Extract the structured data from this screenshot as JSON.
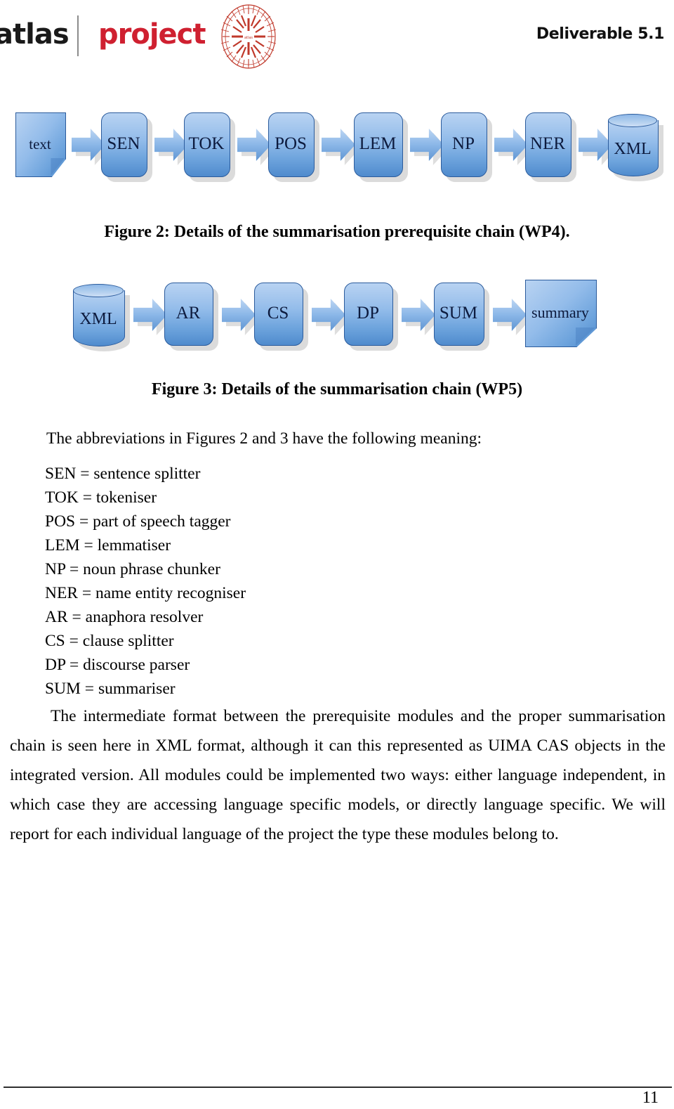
{
  "header": {
    "logo_atlas": "atlas",
    "logo_project": "project",
    "logo_mark_name": "radial-burst-logo",
    "deliverable": "Deliverable 5.1",
    "brand_red": "#cf2030",
    "brand_black": "#1a1a1a"
  },
  "figure2": {
    "caption": "Figure 2: Details of the summarisation prerequisite chain (WP4).",
    "nodes": [
      {
        "label": "text",
        "shape": "document"
      },
      {
        "label": "SEN",
        "shape": "process"
      },
      {
        "label": "TOK",
        "shape": "process"
      },
      {
        "label": "POS",
        "shape": "process"
      },
      {
        "label": "LEM",
        "shape": "process"
      },
      {
        "label": "NP",
        "shape": "process"
      },
      {
        "label": "NER",
        "shape": "process"
      },
      {
        "label": "XML",
        "shape": "cylinder"
      }
    ]
  },
  "figure3": {
    "caption": "Figure 3: Details of the summarisation chain (WP5)",
    "nodes": [
      {
        "label": "XML",
        "shape": "cylinder"
      },
      {
        "label": "AR",
        "shape": "process"
      },
      {
        "label": "CS",
        "shape": "process"
      },
      {
        "label": "DP",
        "shape": "process"
      },
      {
        "label": "SUM",
        "shape": "process"
      },
      {
        "label": "summary",
        "shape": "document"
      }
    ]
  },
  "content": {
    "intro": "The abbreviations in Figures 2 and 3 have the following meaning:",
    "abbreviations": [
      "SEN = sentence splitter",
      "TOK = tokeniser",
      "POS = part of speech tagger",
      "LEM = lemmatiser",
      "NP = noun phrase chunker",
      "NER = name entity recogniser",
      "AR = anaphora resolver",
      "CS = clause splitter",
      "DP = discourse parser",
      "SUM = summariser"
    ],
    "paragraph": "The intermediate format between the prerequisite modules and the proper summarisation chain is seen here in XML format, although it can this represented as UIMA CAS objects in the integrated version. All modules could be implemented two ways: either language independent, in which case they are accessing language specific models, or directly language specific. We will report for each individual language of the project the type these modules belong to."
  },
  "footer": {
    "page_number": "11"
  },
  "diagram_colors": {
    "fill_top": "#b9d3f2",
    "fill_bottom": "#4f8bcd",
    "stroke": "#2b5b9c",
    "shadow": "#bebebe",
    "text": "#0d1b3e"
  }
}
